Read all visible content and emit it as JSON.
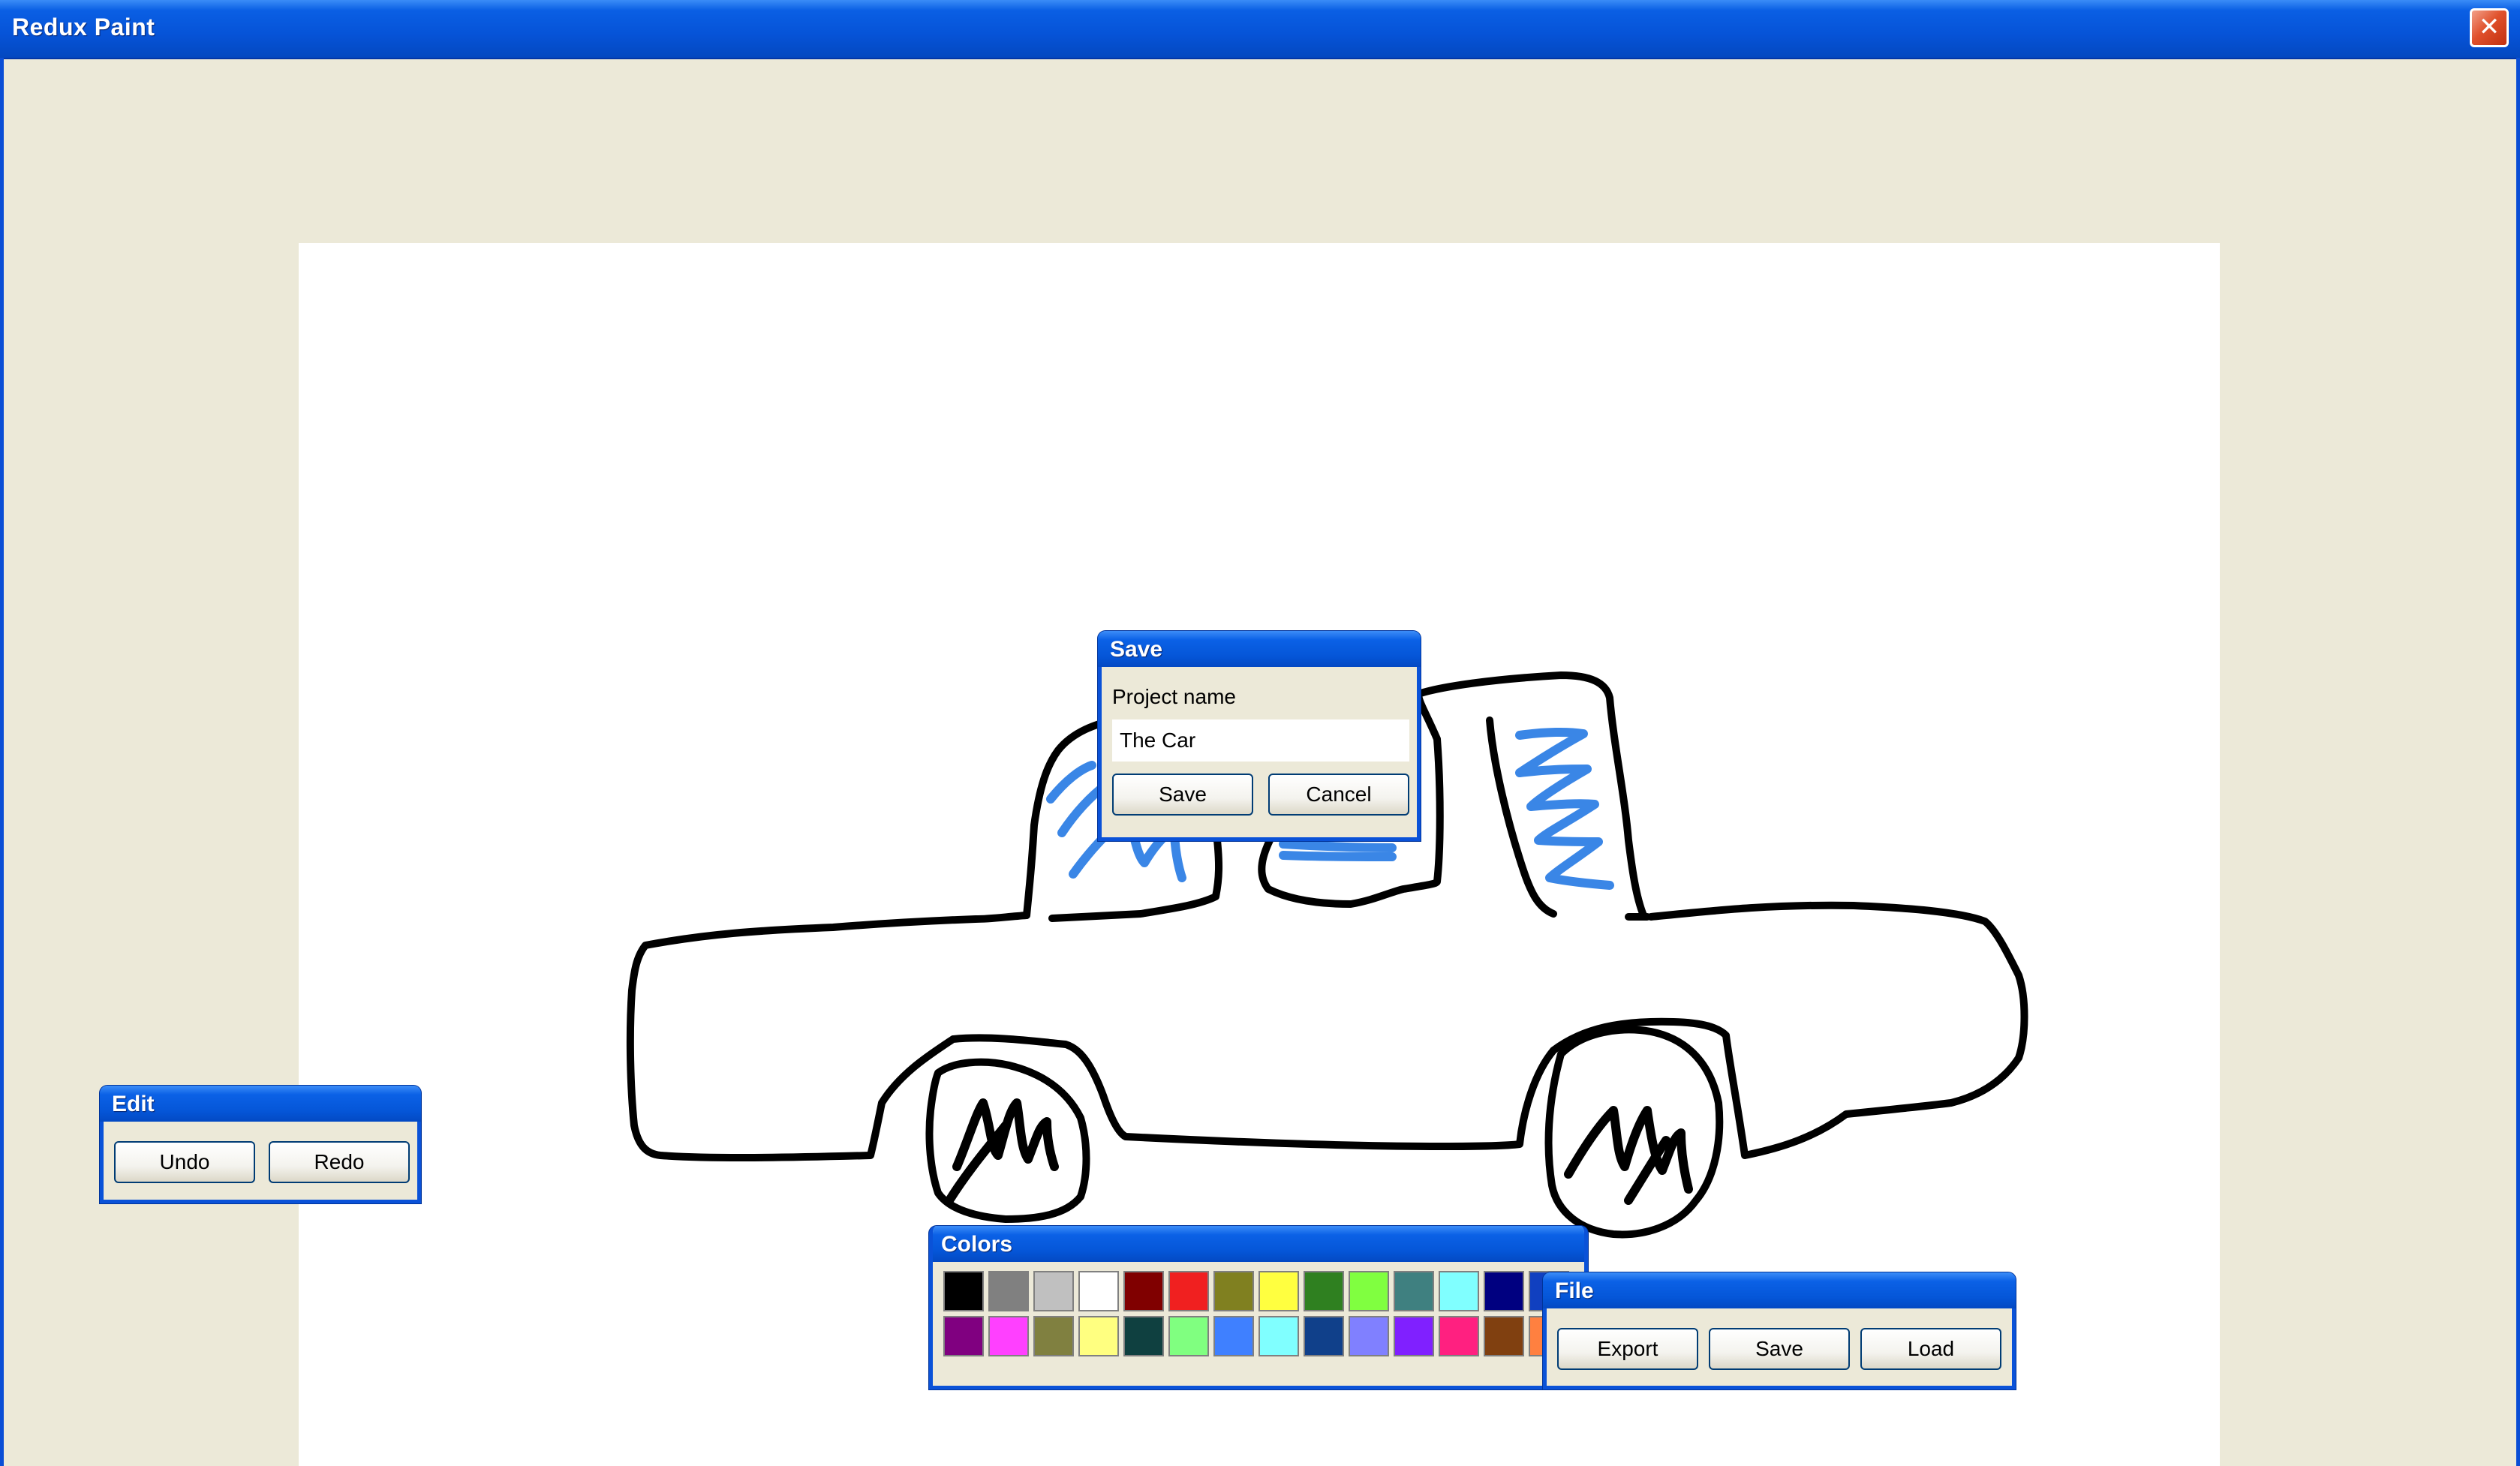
{
  "window": {
    "title": "Redux Paint",
    "close_glyph": "✕"
  },
  "save_dialog": {
    "title": "Save",
    "field_label": "Project name",
    "field_value": "The Car",
    "save_label": "Save",
    "cancel_label": "Cancel"
  },
  "edit_panel": {
    "title": "Edit",
    "undo_label": "Undo",
    "redo_label": "Redo"
  },
  "colors_panel": {
    "title": "Colors",
    "row1": [
      "#000000",
      "#808080",
      "#C0C0C0",
      "#FFFFFF",
      "#800000",
      "#F02020",
      "#808020",
      "#FFFF40",
      "#2F8020",
      "#80FF40",
      "#3F8080",
      "#80FFFF",
      "#000080",
      "#1040C0"
    ],
    "row2": [
      "#800080",
      "#FF40FF",
      "#808040",
      "#FFFF80",
      "#0F4040",
      "#80FF80",
      "#3F80FF",
      "#80FFFF",
      "#10408A",
      "#8080FF",
      "#8020FF",
      "#FF2080",
      "#804010",
      "#FF8040"
    ]
  },
  "file_panel": {
    "title": "File",
    "export_label": "Export",
    "save_label": "Save",
    "load_label": "Load"
  },
  "drawing": {
    "subject": "car",
    "outline_color": "#000000",
    "window_scribble_color": "#3A86E6"
  }
}
